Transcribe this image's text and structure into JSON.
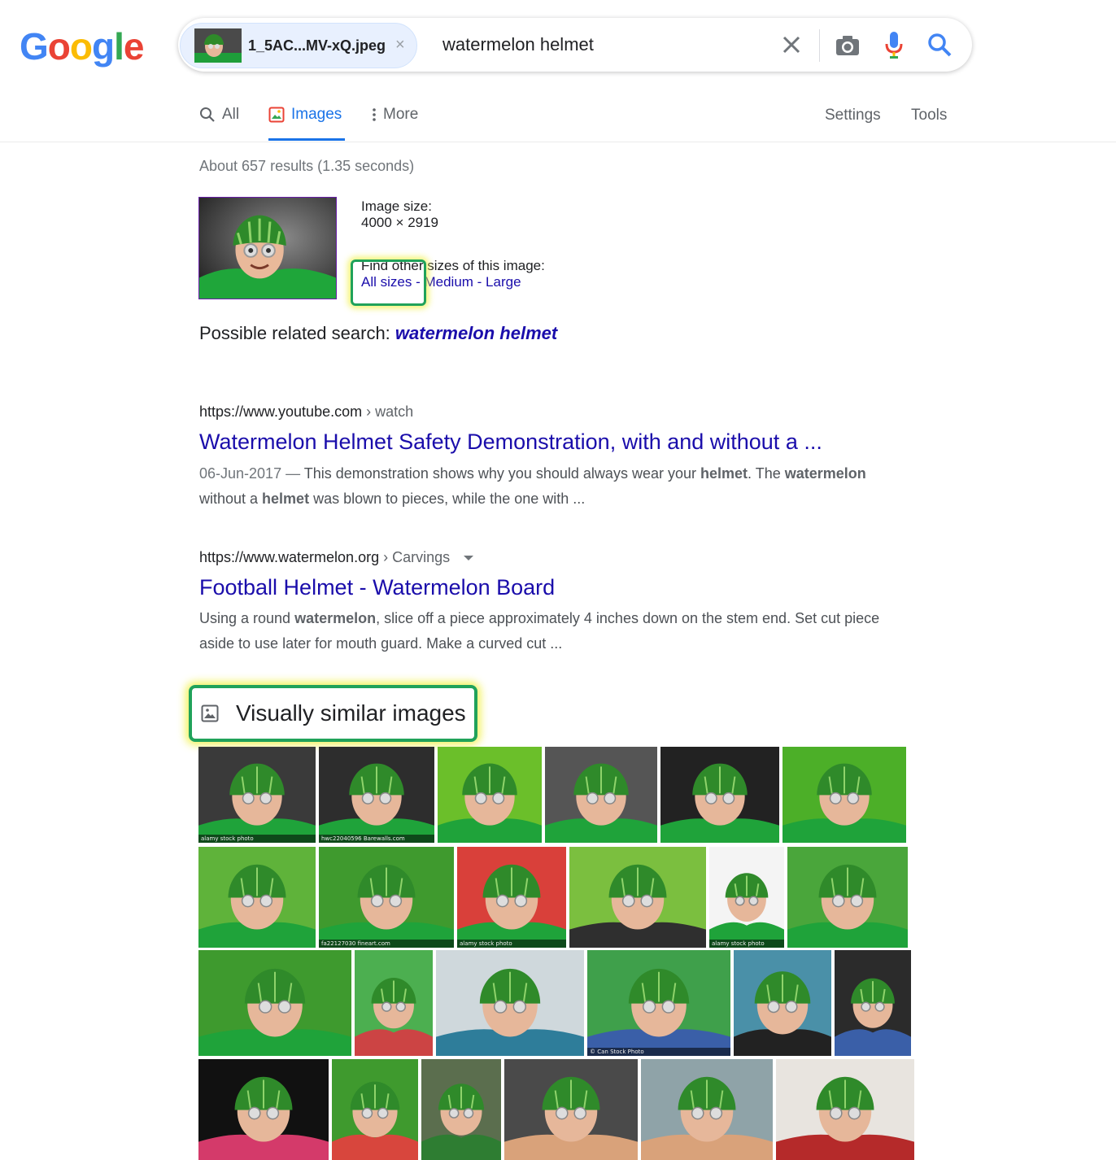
{
  "logo": {
    "letters": [
      "G",
      "o",
      "o",
      "g",
      "l",
      "e"
    ],
    "colors": [
      "#4285F4",
      "#EA4335",
      "#FBBC05",
      "#4285F4",
      "#34A853",
      "#EA4335"
    ]
  },
  "search": {
    "image_chip": {
      "filename": "1_5AC...MV-xQ.jpeg",
      "close_glyph": "×"
    },
    "query": "watermelon helmet"
  },
  "tabs": [
    {
      "label": "All",
      "icon": "search-icon",
      "active": false
    },
    {
      "label": "Images",
      "icon": "image-icon",
      "active": true
    },
    {
      "label": "More",
      "icon": "kebab-icon",
      "active": false
    }
  ],
  "header_links": {
    "settings": "Settings",
    "tools": "Tools"
  },
  "stats": "About 657 results (1.35 seconds)",
  "image_info": {
    "size_label": "Image size:",
    "size_value": "4000 × 2919",
    "other_sizes_label": "Find other sizes of this image:",
    "all_sizes": "All sizes",
    "sep": " - ",
    "medium": "Medium",
    "large": "Large"
  },
  "related": {
    "label": "Possible related search:",
    "term": "watermelon helmet"
  },
  "results": [
    {
      "url": "https://www.youtube.com",
      "breadcrumb": "› watch",
      "title": "Watermelon Helmet Safety Demonstration, with and without a ...",
      "date": "06-Jun-2017 —",
      "snippet_parts": [
        " This demonstration shows why you should always wear your ",
        "helmet",
        ". The ",
        "watermelon",
        " without a ",
        "helmet",
        " was blown to pieces, while the one with ..."
      ]
    },
    {
      "url": "https://www.watermelon.org",
      "breadcrumb": "› Carvings",
      "title": "Football Helmet - Watermelon Board",
      "snippet_parts": [
        "Using a round ",
        "watermelon",
        ", slice off a piece approximately 4 inches down on the stem end. Set cut piece aside to use later for mouth guard. Make a curved cut ..."
      ]
    }
  ],
  "similar": {
    "label": "Visually similar images",
    "rows": [
      [
        {
          "bg": "#3a3a3a",
          "accent": "#1fa33a",
          "caption": "alamy stock photo"
        },
        {
          "bg": "#2d2d2d",
          "accent": "#1fa33a",
          "caption": "hwc22040596 Barewalls.com"
        },
        {
          "bg": "#6bbf2a",
          "accent": "#1fa33a",
          "caption": ""
        },
        {
          "bg": "#555555",
          "accent": "#1fa33a",
          "caption": ""
        },
        {
          "bg": "#222222",
          "accent": "#1fa33a",
          "caption": ""
        },
        {
          "bg": "#4caf28",
          "accent": "#1fa33a",
          "caption": ""
        }
      ],
      [
        {
          "bg": "#5fb33a",
          "accent": "#1fa33a",
          "caption": ""
        },
        {
          "bg": "#3f9a2e",
          "accent": "#1fa33a",
          "caption": "fa22127030 fineart.com"
        },
        {
          "bg": "#d9403a",
          "accent": "#1fa33a",
          "caption": "alamy stock photo"
        },
        {
          "bg": "#7bbf3f",
          "accent": "#2f2f2f",
          "caption": ""
        },
        {
          "bg": "#f4f4f4",
          "accent": "#1fa33a",
          "caption": "alamy stock photo"
        },
        {
          "bg": "#4aa63b",
          "accent": "#1fa33a",
          "caption": ""
        }
      ],
      [
        {
          "bg": "#3e9a2e",
          "accent": "#1fa33a",
          "caption": ""
        },
        {
          "bg": "#4caf50",
          "accent": "#c44",
          "caption": ""
        },
        {
          "bg": "#cfd8dc",
          "accent": "#2e7d9a",
          "caption": ""
        },
        {
          "bg": "#3fa04b",
          "accent": "#3a5fa8",
          "caption": "© Can Stock Photo"
        },
        {
          "bg": "#4a90a8",
          "accent": "#222",
          "caption": ""
        },
        {
          "bg": "#2b2b2b",
          "accent": "#3a5fa8",
          "caption": ""
        }
      ],
      [
        {
          "bg": "#111111",
          "accent": "#d43a6a",
          "caption": ""
        },
        {
          "bg": "#3f9a2e",
          "accent": "#d8463d",
          "caption": ""
        },
        {
          "bg": "#5b6e4e",
          "accent": "#2e7d32",
          "caption": ""
        },
        {
          "bg": "#4a4a4a",
          "accent": "#d9a27a",
          "caption": ""
        },
        {
          "bg": "#8fa3a8",
          "accent": "#d9a27a",
          "caption": ""
        },
        {
          "bg": "#e8e4df",
          "accent": "#b52a2a",
          "caption": ""
        }
      ]
    ]
  }
}
